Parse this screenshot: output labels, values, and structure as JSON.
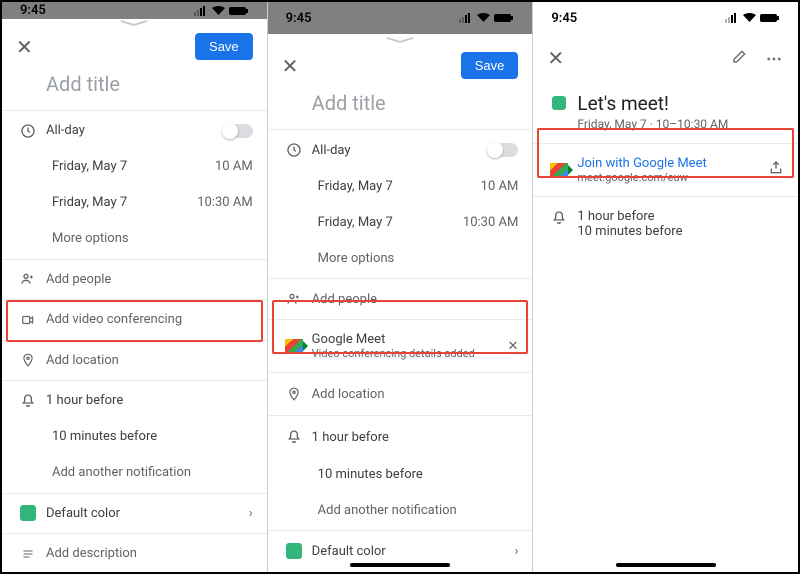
{
  "status": {
    "time": "9:45"
  },
  "pane1": {
    "save": "Save",
    "title_placeholder": "Add title",
    "allday": "All-day",
    "date": "Friday, May 7",
    "start": "10 AM",
    "end": "10:30 AM",
    "more_options": "More options",
    "add_people": "Add people",
    "add_video": "Add video conferencing",
    "add_location": "Add location",
    "notif1": "1 hour before",
    "notif2": "10 minutes before",
    "add_notif": "Add another notification",
    "default_color": "Default color",
    "add_desc": "Add description"
  },
  "pane2": {
    "save": "Save",
    "title_placeholder": "Add title",
    "allday": "All-day",
    "date": "Friday, May 7",
    "start": "10 AM",
    "end": "10:30 AM",
    "more_options": "More options",
    "add_people": "Add people",
    "meet_title": "Google Meet",
    "meet_sub": "Video conferencing details added",
    "add_location": "Add location",
    "notif1": "1 hour before",
    "notif2": "10 minutes before",
    "add_notif": "Add another notification",
    "default_color": "Default color"
  },
  "pane3": {
    "title": "Let's meet!",
    "subtitle": "Friday, May 7 · 10–10:30 AM",
    "join": "Join with Google Meet",
    "join_url": "meet.google.com/euw",
    "notif1": "1 hour before",
    "notif2": "10 minutes before"
  }
}
